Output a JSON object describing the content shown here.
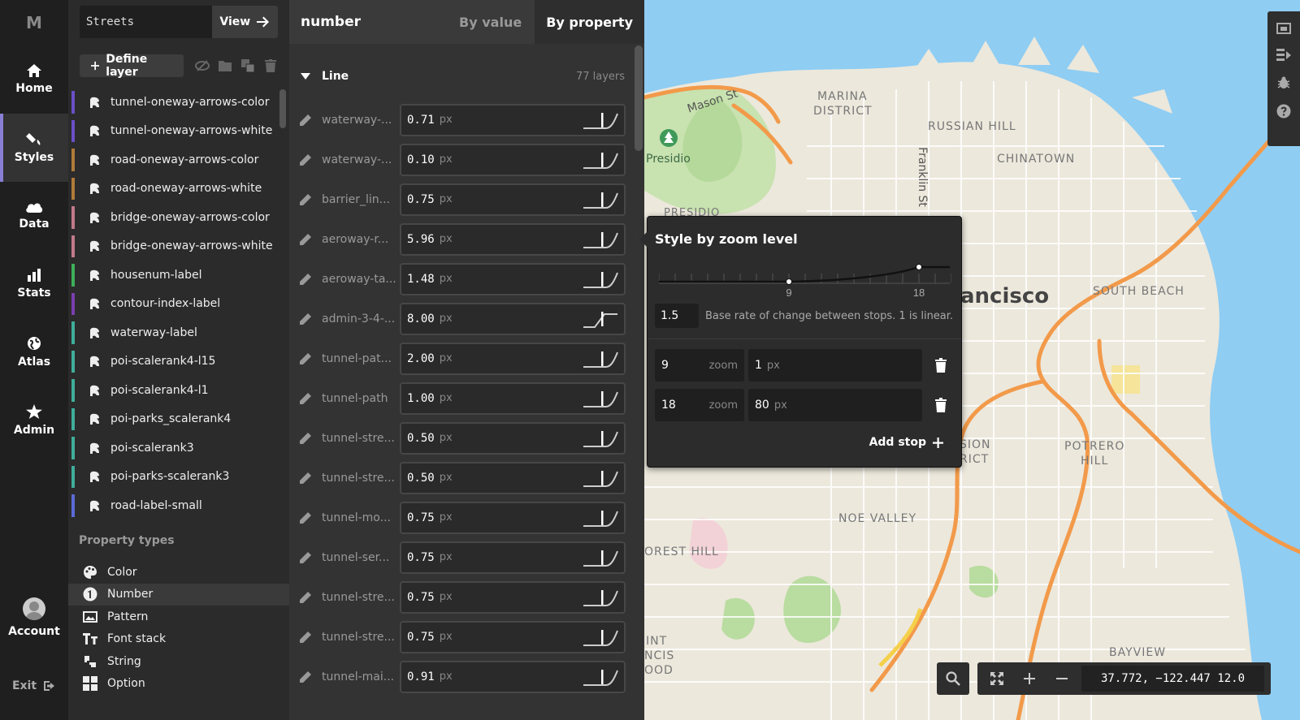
{
  "nav": {
    "logo": "M",
    "items": [
      {
        "label": "Home",
        "icon": "home-icon"
      },
      {
        "label": "Styles",
        "icon": "brush-icon",
        "active": true
      },
      {
        "label": "Data",
        "icon": "cloud-icon"
      },
      {
        "label": "Stats",
        "icon": "bar-chart-icon"
      },
      {
        "label": "Atlas",
        "icon": "globe-icon"
      },
      {
        "label": "Admin",
        "icon": "star-icon"
      }
    ],
    "account_label": "Account",
    "exit_label": "Exit"
  },
  "layers": {
    "style_name": "Streets",
    "view_label": "View",
    "define_label": "Define layer",
    "items": [
      {
        "label": "tunnel-oneway-arrows-color",
        "color": "#6a4fc7"
      },
      {
        "label": "tunnel-oneway-arrows-white",
        "color": "#6a4fc7"
      },
      {
        "label": "road-oneway-arrows-color",
        "color": "#b07a3a"
      },
      {
        "label": "road-oneway-arrows-white",
        "color": "#b07a3a"
      },
      {
        "label": "bridge-oneway-arrows-color",
        "color": "#c07a8a"
      },
      {
        "label": "bridge-oneway-arrows-white",
        "color": "#c07a8a"
      },
      {
        "label": "housenum-label",
        "color": "#3fae5a"
      },
      {
        "label": "contour-index-label",
        "color": "#7a3fae"
      },
      {
        "label": "waterway-label",
        "color": "#3fae9a"
      },
      {
        "label": "poi-scalerank4-l15",
        "color": "#3fae9a"
      },
      {
        "label": "poi-scalerank4-l1",
        "color": "#3fae9a"
      },
      {
        "label": "poi-parks_scalerank4",
        "color": "#3fae9a"
      },
      {
        "label": "poi-scalerank3",
        "color": "#3fae9a"
      },
      {
        "label": "poi-parks-scalerank3",
        "color": "#3fae9a"
      },
      {
        "label": "road-label-small",
        "color": "#5a6ad6"
      }
    ],
    "property_types_heading": "Property types",
    "property_types": [
      {
        "label": "Color",
        "icon": "palette-icon"
      },
      {
        "label": "Number",
        "icon": "number-icon",
        "active": true
      },
      {
        "label": "Pattern",
        "icon": "image-icon"
      },
      {
        "label": "Font stack",
        "icon": "font-icon"
      },
      {
        "label": "String",
        "icon": "string-icon"
      },
      {
        "label": "Option",
        "icon": "grid-icon"
      }
    ]
  },
  "props": {
    "title": "number",
    "tab_by_value": "By value",
    "tab_by_property": "By property",
    "group_name": "Line",
    "group_count": "77 layers",
    "rows": [
      {
        "name": "waterway-...",
        "value": "0.71",
        "unit": "px"
      },
      {
        "name": "waterway-...",
        "value": "0.10",
        "unit": "px"
      },
      {
        "name": "barrier_lin...",
        "value": "0.75",
        "unit": "px"
      },
      {
        "name": "aeroway-r...",
        "value": "5.96",
        "unit": "px"
      },
      {
        "name": "aeroway-ta...",
        "value": "1.48",
        "unit": "px"
      },
      {
        "name": "admin-3-4-...",
        "value": "8.00",
        "unit": "px"
      },
      {
        "name": "tunnel-pat...",
        "value": "2.00",
        "unit": "px"
      },
      {
        "name": "tunnel-path",
        "value": "1.00",
        "unit": "px"
      },
      {
        "name": "tunnel-stre...",
        "value": "0.50",
        "unit": "px"
      },
      {
        "name": "tunnel-stre...",
        "value": "0.50",
        "unit": "px"
      },
      {
        "name": "tunnel-mo...",
        "value": "0.75",
        "unit": "px"
      },
      {
        "name": "tunnel-ser...",
        "value": "0.75",
        "unit": "px"
      },
      {
        "name": "tunnel-stre...",
        "value": "0.75",
        "unit": "px"
      },
      {
        "name": "tunnel-stre...",
        "value": "0.75",
        "unit": "px"
      },
      {
        "name": "tunnel-mai...",
        "value": "0.91",
        "unit": "px"
      }
    ]
  },
  "zoom_popup": {
    "title": "Style by zoom level",
    "stop_labels": [
      "9",
      "18"
    ],
    "base_rate": "1.5",
    "base_rate_help": "Base rate of change between stops. 1 is linear.",
    "stops": [
      {
        "zoom": "9",
        "zoom_unit": "zoom",
        "value": "1",
        "unit": "px"
      },
      {
        "zoom": "18",
        "zoom_unit": "zoom",
        "value": "80",
        "unit": "px"
      }
    ],
    "add_stop_label": "Add stop"
  },
  "map": {
    "labels": {
      "marina": "MARINA",
      "district": "DISTRICT",
      "russian_hill": "RUSSIAN HILL",
      "chinatown": "CHINATOWN",
      "mason_st": "Mason St",
      "presidio": "Presidio",
      "presidio_partial": "PRESIDIO",
      "franklin_st": "Franklin St",
      "sf_partial": "ancisco",
      "south_beach": "SOUTH BEACH",
      "mission_1": "SION",
      "mission_2": "RICT",
      "potrero_1": "POTRERO",
      "potrero_2": "HILL",
      "noe_valley": "NOE VALLEY",
      "forest_hill": "OREST HILL",
      "int": "INT",
      "ncis": "NCIS",
      "ood": "OOD",
      "bayview": "BAYVIEW"
    },
    "coords": "37.772, −122.447 12.0"
  }
}
